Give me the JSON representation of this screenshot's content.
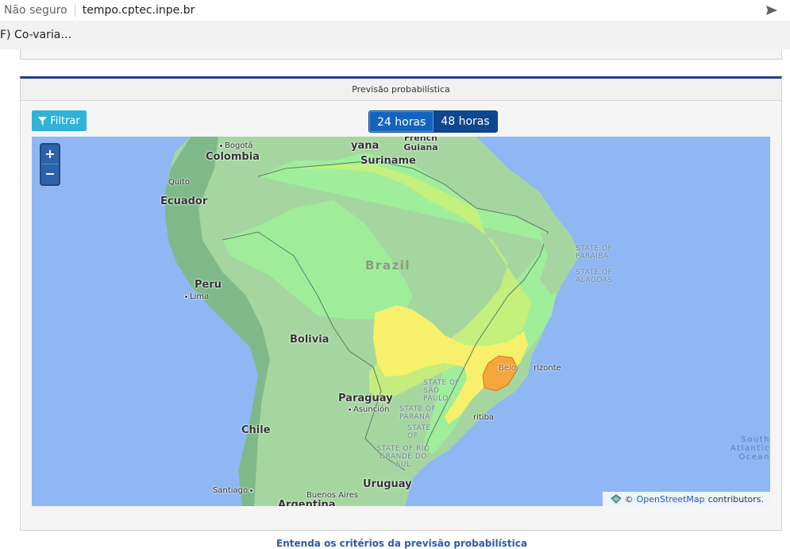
{
  "browser": {
    "security_label": "Não seguro",
    "url": "tempo.cptec.inpe.br",
    "tab_title": "F) Co-varia…"
  },
  "panel": {
    "title": "Previsão probabilística",
    "filter_label": "Filtrar",
    "period_options": [
      "24 horas",
      "48 horas"
    ],
    "selected_period": "24 horas",
    "criteria_link": "Entenda os critérios da previsão probabilística"
  },
  "map": {
    "zoom_in": "+",
    "zoom_out": "−",
    "attribution": {
      "prefix": "©",
      "link": "OpenStreetMap",
      "suffix": "contributors."
    },
    "countries": {
      "colombia": "Colombia",
      "ecuador": "Ecuador",
      "peru": "Peru",
      "bolivia": "Bolivia",
      "paraguay": "Paraguay",
      "chile": "Chile",
      "uruguay": "Uruguay",
      "argentina": "Argentina",
      "brazil": "Brazil",
      "suriname": "Suriname",
      "guyana": "yana",
      "french_guiana": "French Guiana"
    },
    "cities": {
      "bogota": "Bogotá",
      "quito": "Quito",
      "lima": "Lima",
      "asuncion": "Asunción",
      "santiago": "Santiago",
      "buenos_aires": "Buenos Aires",
      "curitiba": "ritiba",
      "belo_horizonte": "rizonte",
      "belo": "Belo"
    },
    "states": {
      "paraiba": "STATE OF PARAÍBA",
      "alagoas": "STATE OF ALAGOAS",
      "sao_paulo": "STATE OF SÃO PAULO",
      "parana": "STATE OF PARANÁ",
      "rio_grande_do_sul": "STATE OF RIO GRANDE DO SUL",
      "santa_catarina": "STATE OF"
    },
    "ocean": "South Atlantic Ocean",
    "colors": {
      "ocean": "#8fb7f3",
      "land": "#a5d6a0",
      "low_prob": "#9ef29a",
      "mid_prob": "#c8f07a",
      "high_prob": "#f7f06a",
      "very_high_prob": "#f5a63c"
    }
  }
}
